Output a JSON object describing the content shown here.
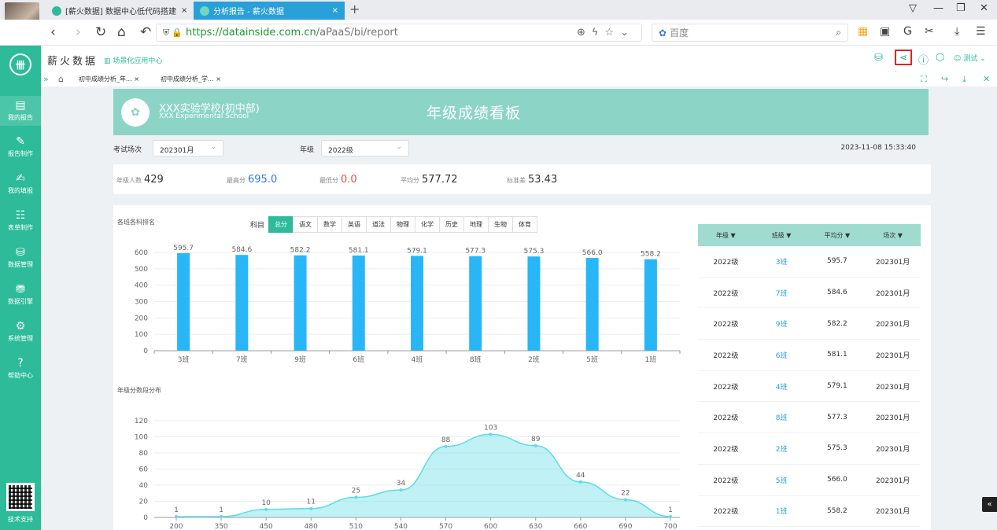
{
  "browser": {
    "tabs": [
      {
        "label": "[薪火数据] 数据中心低代码搭建",
        "close": "×"
      },
      {
        "label": "分析报告 - 薪火数据",
        "close": "×"
      }
    ],
    "new_tab": "+",
    "url_host": "https://datainside.com.cn",
    "url_path": "/aPaaS/bi/report",
    "search_engine": "百度"
  },
  "app": {
    "title": "薪火数据",
    "subtitle": "场景化应用中心",
    "user": "测试",
    "accent_color": "#2dbb9a",
    "highlight_color": "#e02424"
  },
  "sidebar": {
    "items": [
      {
        "label": "我的报告",
        "icon": "report-icon"
      },
      {
        "label": "报告制作",
        "icon": "edit-report-icon"
      },
      {
        "label": "我的填报",
        "icon": "fill-form-icon"
      },
      {
        "label": "表单制作",
        "icon": "form-icon"
      },
      {
        "label": "数据管理",
        "icon": "database-icon"
      },
      {
        "label": "数据引擎",
        "icon": "engine-icon"
      },
      {
        "label": "系统管理",
        "icon": "gear-icon"
      },
      {
        "label": "帮助中心",
        "icon": "help-icon"
      }
    ],
    "support": "技术支持"
  },
  "page_tabs": [
    {
      "label": "初中成绩分析_年...",
      "close": "×"
    },
    {
      "label": "初中成绩分析_学...",
      "close": "×"
    }
  ],
  "banner": {
    "school_cn": "XXX实验学校(初中部)",
    "school_en": "XXX Experimental School",
    "title": "年级成绩看板"
  },
  "filters": {
    "exam_label": "考试场次",
    "exam_value": "202301月",
    "grade_label": "年级",
    "grade_value": "2022级",
    "datetime": "2023-11-08 15:33:40"
  },
  "stats": [
    {
      "label": "年级人数",
      "value": "429"
    },
    {
      "label": "最高分",
      "value": "695.0"
    },
    {
      "label": "最低分",
      "value": "0.0"
    },
    {
      "label": "平均分",
      "value": "577.72"
    },
    {
      "label": "标准差",
      "value": "53.43"
    }
  ],
  "subject_filter": {
    "label": "科目",
    "options": [
      "总分",
      "语文",
      "数学",
      "英语",
      "道法",
      "物理",
      "化学",
      "历史",
      "地理",
      "生物",
      "体育"
    ],
    "selected": "总分"
  },
  "chart_data": [
    {
      "type": "bar",
      "title": "各班各科排名",
      "categories": [
        "3班",
        "7班",
        "9班",
        "6班",
        "4班",
        "8班",
        "2班",
        "5班",
        "1班"
      ],
      "values": [
        595.7,
        584.6,
        582.2,
        581.1,
        579.1,
        577.3,
        575.3,
        566.0,
        558.2
      ],
      "value_labels": [
        "595.7",
        "584.6",
        "582.2",
        "581.1",
        "579.1",
        "577.3",
        "575.3",
        "566.0",
        "558.2"
      ],
      "yticks": [
        0,
        100,
        200,
        300,
        400,
        500,
        600
      ],
      "ylim": [
        0,
        600
      ],
      "color": "#29b6f6",
      "grid": true
    },
    {
      "type": "area",
      "title": "年级分数段分布",
      "x": [
        200,
        350,
        450,
        480,
        510,
        540,
        570,
        600,
        630,
        660,
        690,
        700
      ],
      "values": [
        1,
        1,
        10,
        11,
        25,
        34,
        88,
        103,
        89,
        44,
        22,
        1
      ],
      "yticks": [
        0,
        20,
        40,
        60,
        80,
        100,
        120
      ],
      "ylim": [
        0,
        120
      ],
      "color": "#5fdbe6",
      "grid": true
    }
  ],
  "table": {
    "headers": [
      "年级 ▼",
      "班级 ▼",
      "平均分 ▼",
      "场次 ▼"
    ],
    "rows": [
      [
        "2022级",
        "3班",
        "595.7",
        "202301月"
      ],
      [
        "2022级",
        "7班",
        "584.6",
        "202301月"
      ],
      [
        "2022级",
        "9班",
        "582.2",
        "202301月"
      ],
      [
        "2022级",
        "6班",
        "581.1",
        "202301月"
      ],
      [
        "2022级",
        "4班",
        "579.1",
        "202301月"
      ],
      [
        "2022级",
        "8班",
        "577.3",
        "202301月"
      ],
      [
        "2022级",
        "2班",
        "575.3",
        "202301月"
      ],
      [
        "2022级",
        "5班",
        "566.0",
        "202301月"
      ],
      [
        "2022级",
        "1班",
        "558.2",
        "202301月"
      ]
    ]
  }
}
